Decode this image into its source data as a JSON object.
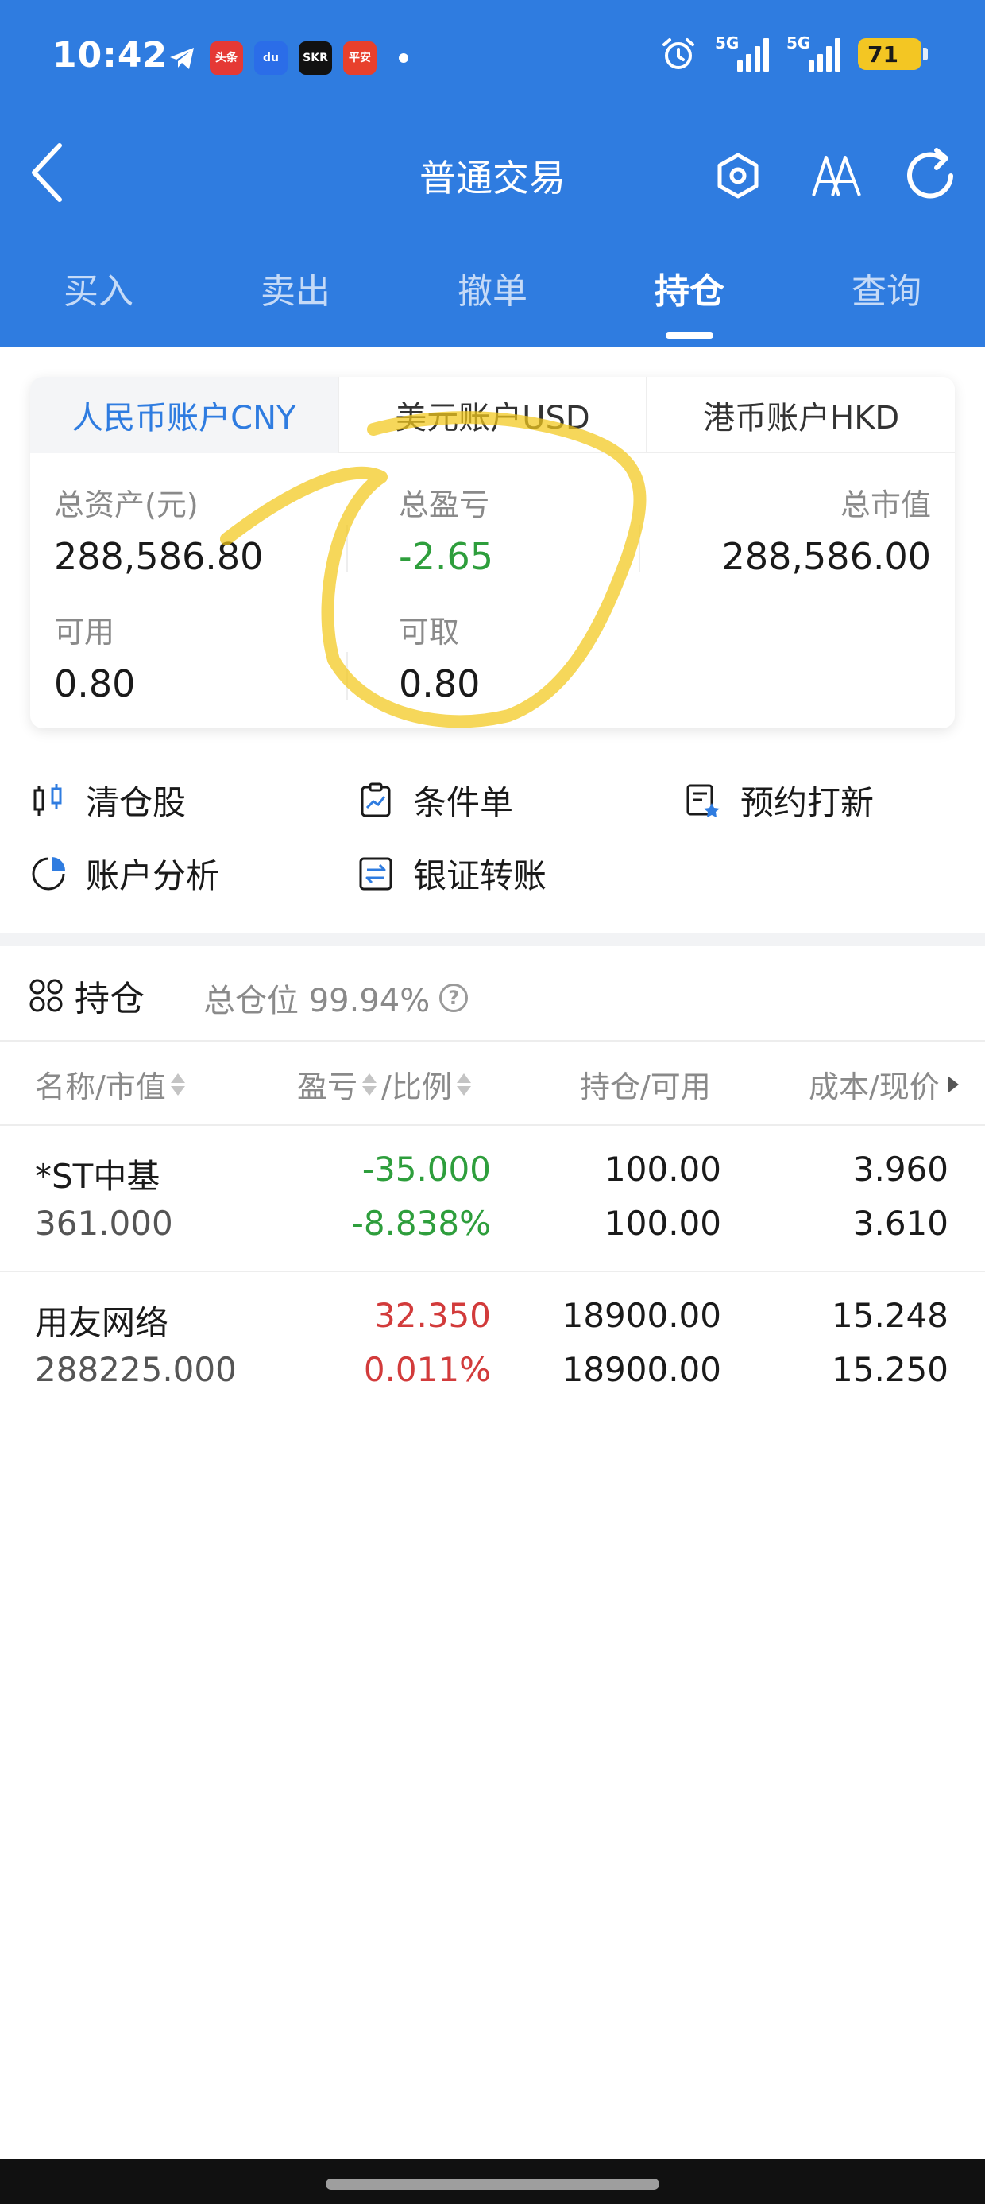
{
  "status_bar": {
    "time": "10:42",
    "apps": [
      {
        "name": "toutiao-app-icon",
        "label": "头条",
        "color": "#e53935"
      },
      {
        "name": "baidu-app-icon",
        "label": "du",
        "color": "#2b6de8"
      },
      {
        "name": "skr-app-icon",
        "label": "SKR",
        "color": "#111111"
      },
      {
        "name": "pingan-bank-app-icon",
        "label": "平安",
        "color": "#e8402c"
      }
    ],
    "signal_1_label": "5G",
    "signal_2_label": "5G",
    "battery": "71"
  },
  "nav": {
    "title": "普通交易"
  },
  "tabs": [
    {
      "label": "买入"
    },
    {
      "label": "卖出"
    },
    {
      "label": "撤单"
    },
    {
      "label": "持仓"
    },
    {
      "label": "查询"
    }
  ],
  "currency_tabs": [
    {
      "label": "人民币账户CNY"
    },
    {
      "label": "美元账户USD"
    },
    {
      "label": "港币账户HKD"
    }
  ],
  "account": {
    "total_assets_label": "总资产(元)",
    "total_assets": "288,586.80",
    "total_pl_label": "总盈亏",
    "total_pl": "-2.65",
    "market_value_label": "总市值",
    "market_value": "288,586.00",
    "available_label": "可用",
    "available": "0.80",
    "withdrawable_label": "可取",
    "withdrawable": "0.80"
  },
  "quick_actions": [
    {
      "label": "清仓股"
    },
    {
      "label": "条件单"
    },
    {
      "label": "预约打新"
    },
    {
      "label": "账户分析"
    },
    {
      "label": "银证转账"
    }
  ],
  "holdings": {
    "title": "持仓",
    "position_label": "总仓位 99.94%",
    "columns": [
      "名称/市值",
      "盈亏",
      "/比例",
      "持仓/可用",
      "成本/现价"
    ],
    "rows": [
      {
        "name": "*ST中基",
        "market_value": "361.000",
        "pl": "-35.000",
        "pl_ratio": "-8.838%",
        "position": "100.00",
        "available": "100.00",
        "cost": "3.960",
        "price": "3.610",
        "pl_color": "green"
      },
      {
        "name": "用友网络",
        "market_value": "288225.000",
        "pl": "32.350",
        "pl_ratio": "0.011%",
        "position": "18900.00",
        "available": "18900.00",
        "cost": "15.248",
        "price": "15.250",
        "pl_color": "red"
      }
    ]
  },
  "colors": {
    "primary": "#2f7ce0",
    "loss": "#2e9e3c",
    "gain": "#d23b3b",
    "annotation": "#f2c81a"
  }
}
